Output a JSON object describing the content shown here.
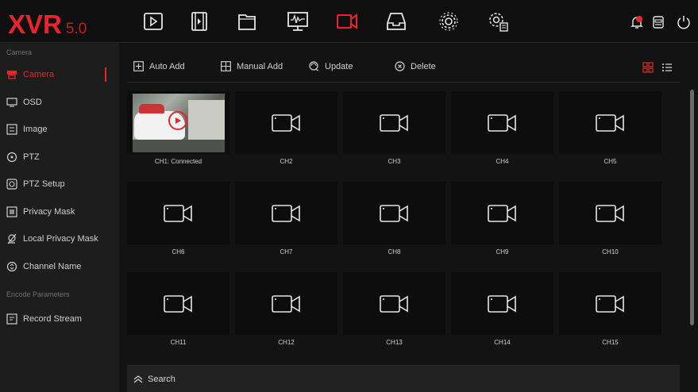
{
  "app": {
    "logo": "XVR",
    "version": "5.0"
  },
  "topbar": {
    "nav_icons": [
      "playback-icon",
      "video-clip-icon",
      "folder-icon",
      "system-info-icon",
      "camera-icon",
      "storage-icon",
      "settings-icon",
      "advanced-settings-icon"
    ],
    "active_icon": "camera-icon",
    "right_icons": [
      "alarm-bell-icon",
      "backup-icon",
      "power-icon"
    ]
  },
  "sidebar": {
    "group1": "Camera",
    "items1": [
      {
        "label": "Camera",
        "icon": "camera-icon",
        "active": true
      },
      {
        "label": "OSD",
        "icon": "osd-icon"
      },
      {
        "label": "Image",
        "icon": "image-icon"
      },
      {
        "label": "PTZ",
        "icon": "ptz-icon"
      },
      {
        "label": "PTZ Setup",
        "icon": "ptz-setup-icon"
      },
      {
        "label": "Privacy Mask",
        "icon": "privacy-mask-icon"
      },
      {
        "label": "Local Privacy Mask",
        "icon": "local-privacy-mask-icon"
      },
      {
        "label": "Channel Name",
        "icon": "channel-name-icon"
      }
    ],
    "group2": "Encode Parameters",
    "items2": [
      {
        "label": "Record Stream",
        "icon": "record-stream-icon"
      }
    ]
  },
  "toolbar": {
    "auto_add": "Auto Add",
    "manual_add": "Manual Add",
    "update": "Update",
    "delete": "Delete",
    "view_modes": [
      "grid-view-icon",
      "list-view-icon"
    ]
  },
  "channels": [
    {
      "label": "CH1: Connected",
      "connected": true
    },
    {
      "label": "CH2"
    },
    {
      "label": "CH3"
    },
    {
      "label": "CH4"
    },
    {
      "label": "CH5"
    },
    {
      "label": "CH6"
    },
    {
      "label": "CH7"
    },
    {
      "label": "CH8"
    },
    {
      "label": "CH9"
    },
    {
      "label": "CH10"
    },
    {
      "label": "CH11"
    },
    {
      "label": "CH12"
    },
    {
      "label": "CH13"
    },
    {
      "label": "CH14"
    },
    {
      "label": "CH15"
    }
  ],
  "search": {
    "label": "Search"
  },
  "colors": {
    "accent": "#e8242c",
    "background": "#131313",
    "sidebar": "#1d1d1d",
    "tile": "#0d0d0d"
  }
}
